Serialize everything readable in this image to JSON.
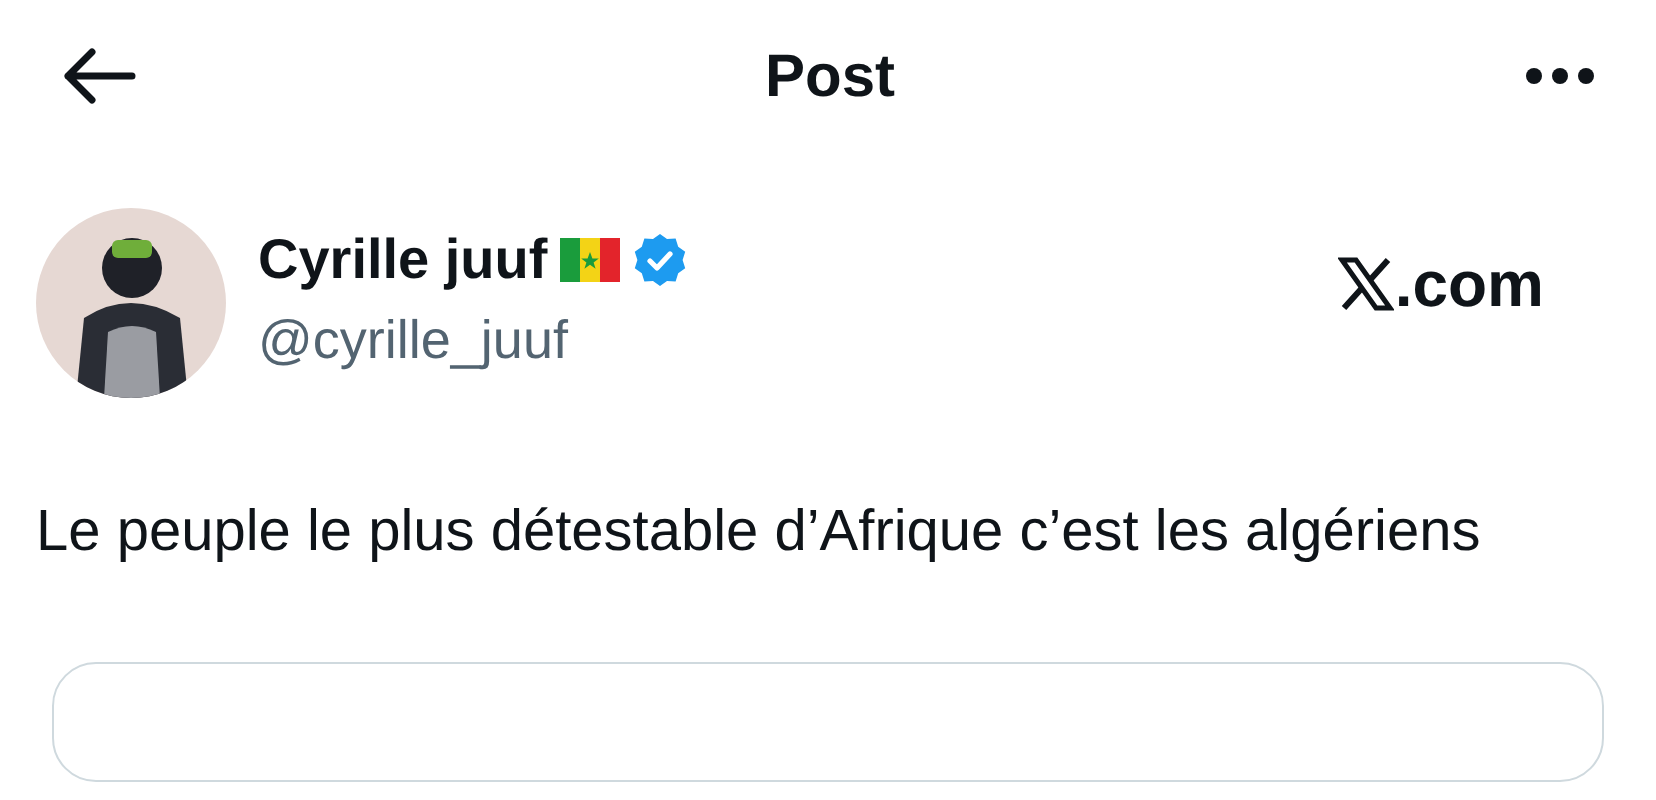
{
  "header": {
    "title": "Post"
  },
  "author": {
    "name": "Cyrille juuf",
    "verified": true,
    "handle": "@cyrille_juuf"
  },
  "source": {
    "suffix": ".com"
  },
  "post": {
    "text": "Le peuple le plus détestable d’Afrique c’est les algériens"
  }
}
